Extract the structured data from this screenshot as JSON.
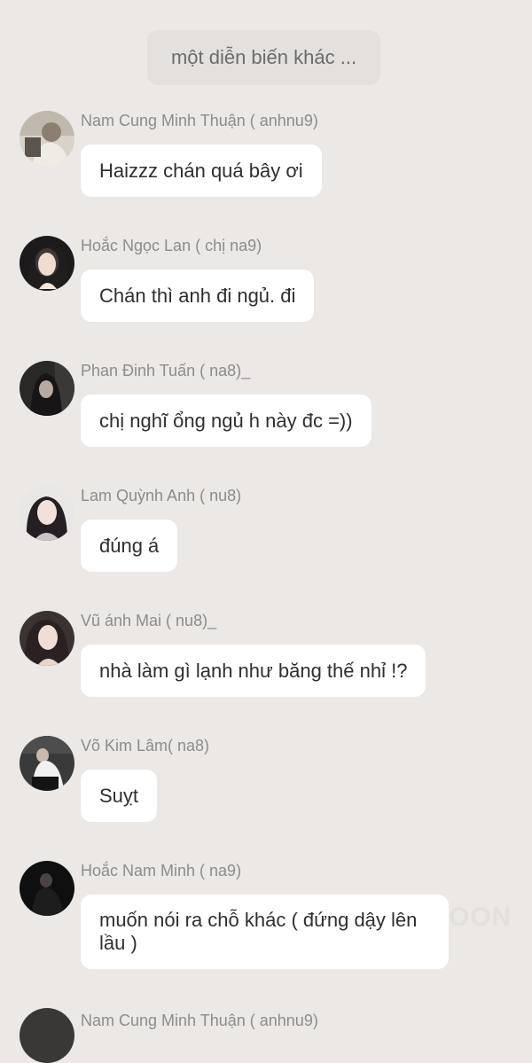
{
  "divider": {
    "label": "một diễn biến khác ..."
  },
  "messages": [
    {
      "sender": "Nam Cung Minh Thuận ( anhnu9)",
      "text": "Haizzz chán quá bây ơi",
      "avatar": "avatar-photo"
    },
    {
      "sender": "Hoắc Ngọc  Lan  ( chị na9)",
      "text": "Chán thì anh đi ngủ. đi",
      "avatar": "avatar-photo"
    },
    {
      "sender": "Phan Đinh Tuấn ( na8)_",
      "text": "chị nghĩ ổng ngủ h này đc =))",
      "avatar": "avatar-photo"
    },
    {
      "sender": "Lam Quỳnh Anh ( nu8)",
      "text": "đúng á",
      "avatar": "avatar-photo"
    },
    {
      "sender": "Vũ ánh Mai ( nu8)_",
      "text": "nhà làm gì lạnh như băng thế nhỉ !?",
      "avatar": "avatar-photo"
    },
    {
      "sender": "Võ Kim Lâm( na8)",
      "text": "Suỵt",
      "avatar": "avatar-photo"
    },
    {
      "sender": "Hoắc Nam Minh ( na9)",
      "text": "muốn nói ra chỗ khác ( đứng dậy lên lầu )",
      "avatar": "avatar-photo"
    }
  ],
  "partial_message": {
    "sender": "Nam Cung Minh Thuận ( anhnu9)"
  },
  "watermark": "OON",
  "colors": {
    "background": "#ebe8e5",
    "bubble": "#ffffff",
    "divider": "#e3e0dd",
    "sender_text": "#8c8c8c",
    "message_text": "#2f2f2f"
  }
}
